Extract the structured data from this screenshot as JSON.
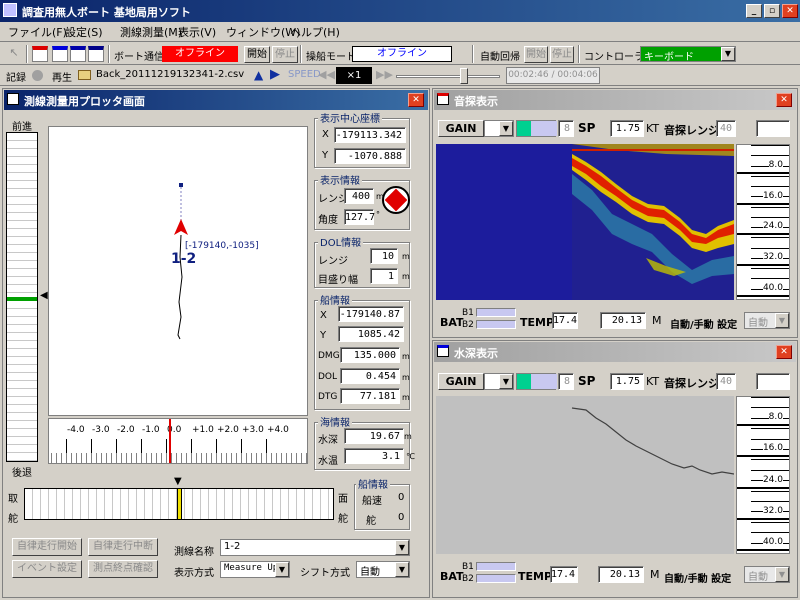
{
  "app": {
    "title": "調査用無人ボート 基地局用ソフト"
  },
  "menu": [
    "ファイル(F)",
    "設定(S)",
    "測線測量(M)",
    "表示(V)",
    "ウィンドウ(W)",
    "ヘルプ(H)"
  ],
  "toolbar": {
    "boat_comm_label": "ボート通信",
    "boat_comm_status": "オフライン",
    "start_label": "開始",
    "stop_label": "停止",
    "mode_label": "操船モード",
    "mode_status": "オフライン",
    "auto_return_label": "自動回帰",
    "start2_label": "開始",
    "stop2_label": "停止",
    "controller_label": "コントローラ系",
    "controller_value": "キーボード"
  },
  "playback": {
    "record_label": "記録",
    "play_label": "再生",
    "file_name": "Back_20111219132341-2.csv",
    "speed_label": "SPEED",
    "speed_value": "×1",
    "time": "00:02:46 / 00:04:06"
  },
  "plotter": {
    "title": "測線測量用プロッタ画面",
    "forward_label": "前進",
    "backward_label": "後退",
    "boat_label": "1-2",
    "coord_label": "[-179140,-1035]",
    "scale_ticks": [
      "-4.0",
      "-3.0",
      "-2.0",
      "-1.0",
      "0.0",
      "+1.0",
      "+2.0",
      "+3.0",
      "+4.0"
    ],
    "rudder_left_top": "取",
    "rudder_left_bottom": "舵",
    "rudder_right_top": "面",
    "rudder_right_bottom": "舵",
    "center_coords": {
      "title": "表示中心座標",
      "x_label": "X",
      "x": "-179113.342",
      "y_label": "Y",
      "y": "-1070.888"
    },
    "display_info": {
      "title": "表示情報",
      "range_label": "レンジ",
      "range": "400",
      "range_unit": "m",
      "angle_label": "角度",
      "angle": "127.7",
      "angle_unit": "°"
    },
    "dol_info": {
      "title": "DOL情報",
      "range_label": "レンジ",
      "range": "10",
      "range_unit": "m",
      "scale_label": "目盛り幅",
      "scale": "1",
      "scale_unit": "m"
    },
    "boat_info": {
      "title": "船情報",
      "x_label": "X",
      "x": "-179140.87",
      "y_label": "Y",
      "y": "1085.42",
      "dmg_label": "DMG",
      "dmg": "135.000",
      "dmg_unit": "m",
      "dol_label": "DOL",
      "dol": "0.454",
      "dol_unit": "m",
      "dtg_label": "DTG",
      "dtg": "77.181",
      "dtg_unit": "m"
    },
    "sea_info": {
      "title": "海情報",
      "depth_label": "水深",
      "depth": "19.67",
      "depth_unit": "m",
      "temp_label": "水温",
      "temp": "3.1",
      "temp_unit": "℃"
    },
    "ship_info": {
      "title": "船情報",
      "speed_label": "船速",
      "speed": "0",
      "rudder_label": "舵",
      "rudder": "0"
    },
    "buttons": {
      "auto_start": "自律走行開始",
      "auto_stop": "自律走行中断",
      "event": "イベント設定",
      "measure_end": "測点終点確認"
    },
    "line_name_label": "測線名称",
    "line_name_value": "1-2",
    "display_mode_label": "表示方式",
    "display_mode_value": "Measure Up",
    "shift_mode_label": "シフト方式",
    "shift_mode_value": "自動"
  },
  "sonar": {
    "title": "音探表示",
    "gain_label": "GAIN",
    "gain_value": "8",
    "sp_label": "SP",
    "sp_value": "1.75",
    "kt_label": "KT",
    "range_label": "音探レンジ",
    "range_value": "40",
    "depth_ticks": [
      "8.0",
      "16.0",
      "24.0",
      "32.0",
      "40.0"
    ],
    "bat_label": "BAT",
    "b1_label": "B1",
    "b2_label": "B2",
    "temp_label": "TEMP",
    "temp_value": "17.4",
    "depth_value": "20.13",
    "depth_unit": "M",
    "mode_label": "自動/手動 設定",
    "mode_value": "自動"
  },
  "depth_win": {
    "title": "水深表示",
    "gain_label": "GAIN",
    "gain_value": "8",
    "sp_label": "SP",
    "sp_value": "1.75",
    "kt_label": "KT",
    "range_label": "音探レンジ",
    "range_value": "40",
    "depth_ticks": [
      "8.0",
      "16.0",
      "24.0",
      "32.0",
      "40.0"
    ],
    "bat_label": "BAT",
    "b1_label": "B1",
    "b2_label": "B2",
    "temp_label": "TEMP",
    "temp_value": "17.4",
    "depth_value": "20.13",
    "depth_unit": "M",
    "mode_label": "自動/手動 設定",
    "mode_value": "自動"
  },
  "colors": {
    "offline_red": "#ff0000",
    "plotter_bg": "#ffffff",
    "sonar_bg": "#1c1c9c",
    "depth_bg": "#c0c0c0"
  }
}
